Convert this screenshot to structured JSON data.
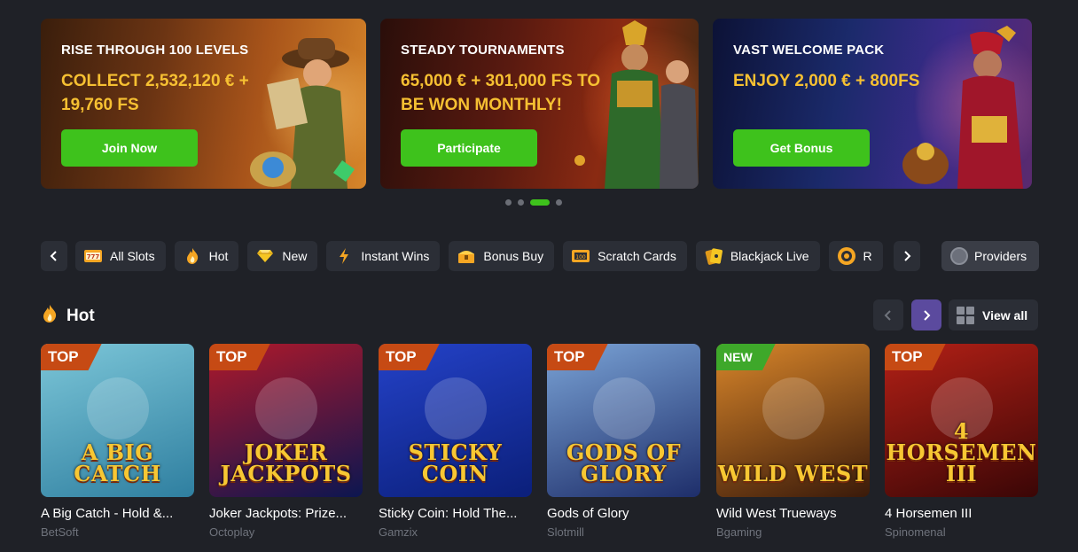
{
  "banners": [
    {
      "title": "RISE THROUGH 100 LEVELS",
      "subtitle": "COLLECT 2,532,120 € + 19,760 FS",
      "button": "Join Now"
    },
    {
      "title": "STEADY TOURNAMENTS",
      "subtitle": "65,000 € + 301,000 FS TO BE WON MONTHLY!",
      "button": "Participate"
    },
    {
      "title": "VAST WELCOME PACK",
      "subtitle": "ENJOY 2,000 € + 800FS",
      "button": "Get Bonus"
    }
  ],
  "carousel": {
    "total": 4,
    "active_index": 2
  },
  "categories": [
    {
      "label": "All Slots",
      "icon": "slot-777-icon"
    },
    {
      "label": "Hot",
      "icon": "flame-icon"
    },
    {
      "label": "New",
      "icon": "diamond-icon"
    },
    {
      "label": "Instant Wins",
      "icon": "lightning-icon"
    },
    {
      "label": "Bonus Buy",
      "icon": "chest-icon"
    },
    {
      "label": "Scratch Cards",
      "icon": "scratch-card-icon"
    },
    {
      "label": "Blackjack Live",
      "icon": "cards-icon"
    },
    {
      "label": "R",
      "icon": "roulette-icon"
    }
  ],
  "providers_label": "Providers",
  "section": {
    "title": "Hot",
    "view_all": "View all"
  },
  "games": [
    {
      "name": "A Big Catch - Hold &...",
      "provider": "BetSoft",
      "badge": "TOP",
      "art_text": "A BIG CATCH",
      "colors": [
        "#2f7fa0",
        "#7cc6d8"
      ]
    },
    {
      "name": "Joker Jackpots: Prize...",
      "provider": "Octoplay",
      "badge": "TOP",
      "art_text": "JOKER JACKPOTS",
      "colors": [
        "#0c1650",
        "#b0182a"
      ]
    },
    {
      "name": "Sticky Coin: Hold The...",
      "provider": "Gamzix",
      "badge": "TOP",
      "art_text": "STICKY COIN",
      "colors": [
        "#0b1f7a",
        "#2442c8"
      ]
    },
    {
      "name": "Gods of Glory",
      "provider": "Slotmill",
      "badge": "TOP",
      "art_text": "GODS OF GLORY",
      "colors": [
        "#1e2e6a",
        "#7aa3d6"
      ]
    },
    {
      "name": "Wild West Trueways",
      "provider": "Bgaming",
      "badge": "NEW",
      "art_text": "WILD WEST",
      "colors": [
        "#3a1a0a",
        "#d9862a"
      ]
    },
    {
      "name": "4 Horsemen III",
      "provider": "Spinomenal",
      "badge": "TOP",
      "art_text": "4 HORSEMEN III",
      "colors": [
        "#3a0606",
        "#b32016"
      ]
    }
  ]
}
